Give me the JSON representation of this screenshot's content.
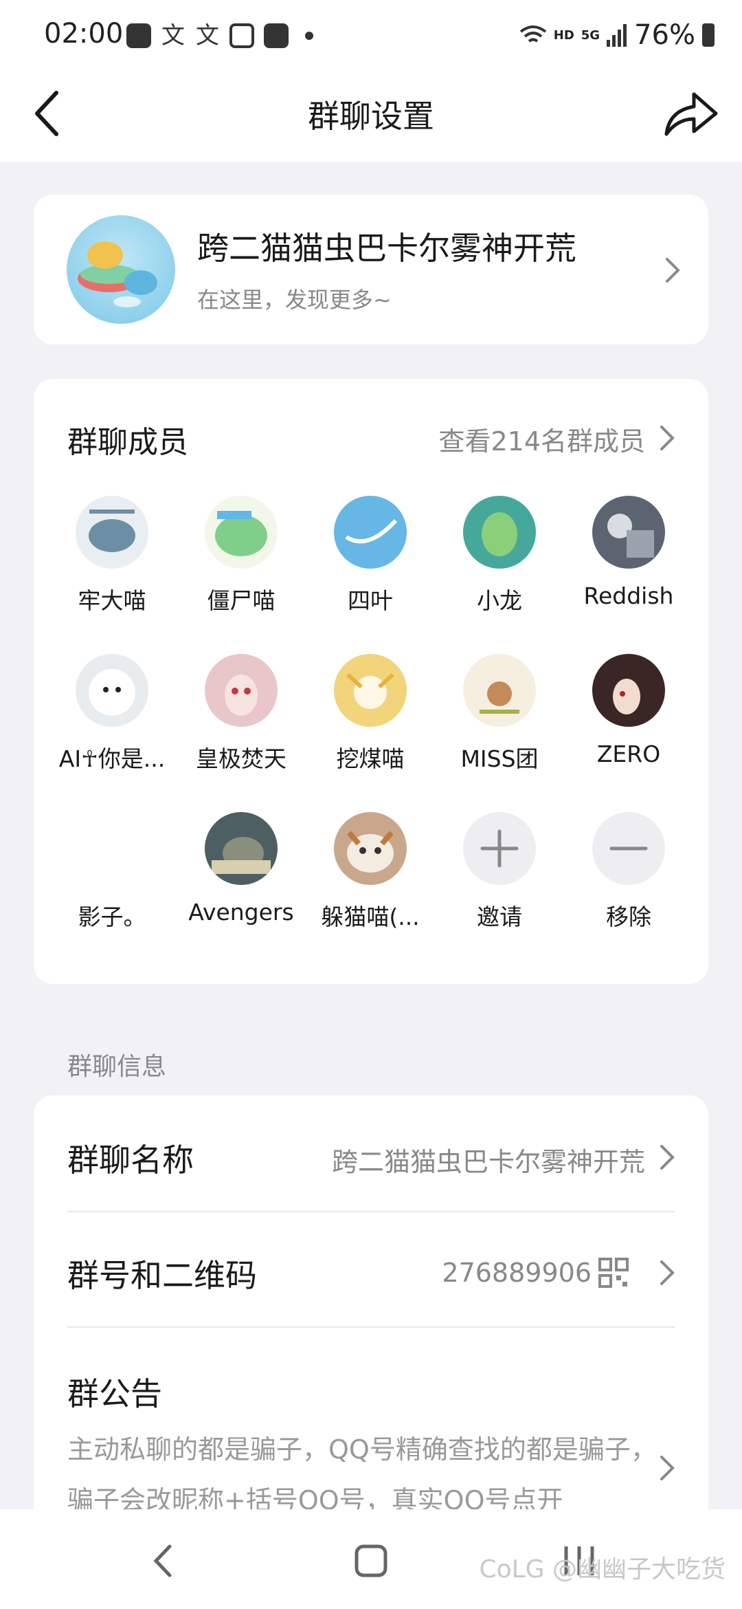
{
  "status_bar": {
    "time": "02:00",
    "battery": "76%",
    "network": "5G",
    "hd": "HD",
    "icons": [
      "todo-icon",
      "app-icon",
      "app-icon",
      "bilibili-icon",
      "check-icon",
      "dot-icon",
      "wifi-icon",
      "signal-icon",
      "battery-icon"
    ]
  },
  "navbar": {
    "title": "群聊设置",
    "back_icon": "back-arrow-icon",
    "share_icon": "share-arrow-icon"
  },
  "group": {
    "name": "跨二猫猫虫巴卡尔雾神开荒",
    "subtitle": "在这里，发现更多~"
  },
  "members": {
    "title": "群聊成员",
    "view_all": "查看214名群成员",
    "items": [
      {
        "name": "牢大喵",
        "color": "#6d8fa5"
      },
      {
        "name": "僵尸喵",
        "color": "#7fcf8a"
      },
      {
        "name": "四叶",
        "color": "#66b6e6"
      },
      {
        "name": "小龙",
        "color": "#45a89a"
      },
      {
        "name": "Reddish",
        "color": "#5d6471"
      },
      {
        "name": "AI☥你是...",
        "color": "#e8ecef"
      },
      {
        "name": "皇极焚天",
        "color": "#e9c6c9"
      },
      {
        "name": "挖煤喵",
        "color": "#f2d57b"
      },
      {
        "name": "MISS团",
        "color": "#f6efe0"
      },
      {
        "name": "ZERO",
        "color": "#3a2624"
      },
      {
        "name": "影子。",
        "color": "#ffffff"
      },
      {
        "name": "Avengers",
        "color": "#4d5f63"
      },
      {
        "name": "躲猫喵(...",
        "color": "#c9a78d"
      },
      {
        "name": "邀请",
        "color": "#eeeef0"
      },
      {
        "name": "移除",
        "color": "#eeeef0"
      }
    ]
  },
  "info": {
    "section_label": "群聊信息",
    "name_label": "群聊名称",
    "name_value": "跨二猫猫虫巴卡尔雾神开荒",
    "number_label": "群号和二维码",
    "number_value": "276889906",
    "notice_label": "群公告",
    "notice_text": "主动私聊的都是骗子，QQ号精确查找的都是骗子，骗子会改昵称+括号QQ号，真实QQ号点开"
  },
  "watermark": "CoLG @幽幽子大吃货"
}
